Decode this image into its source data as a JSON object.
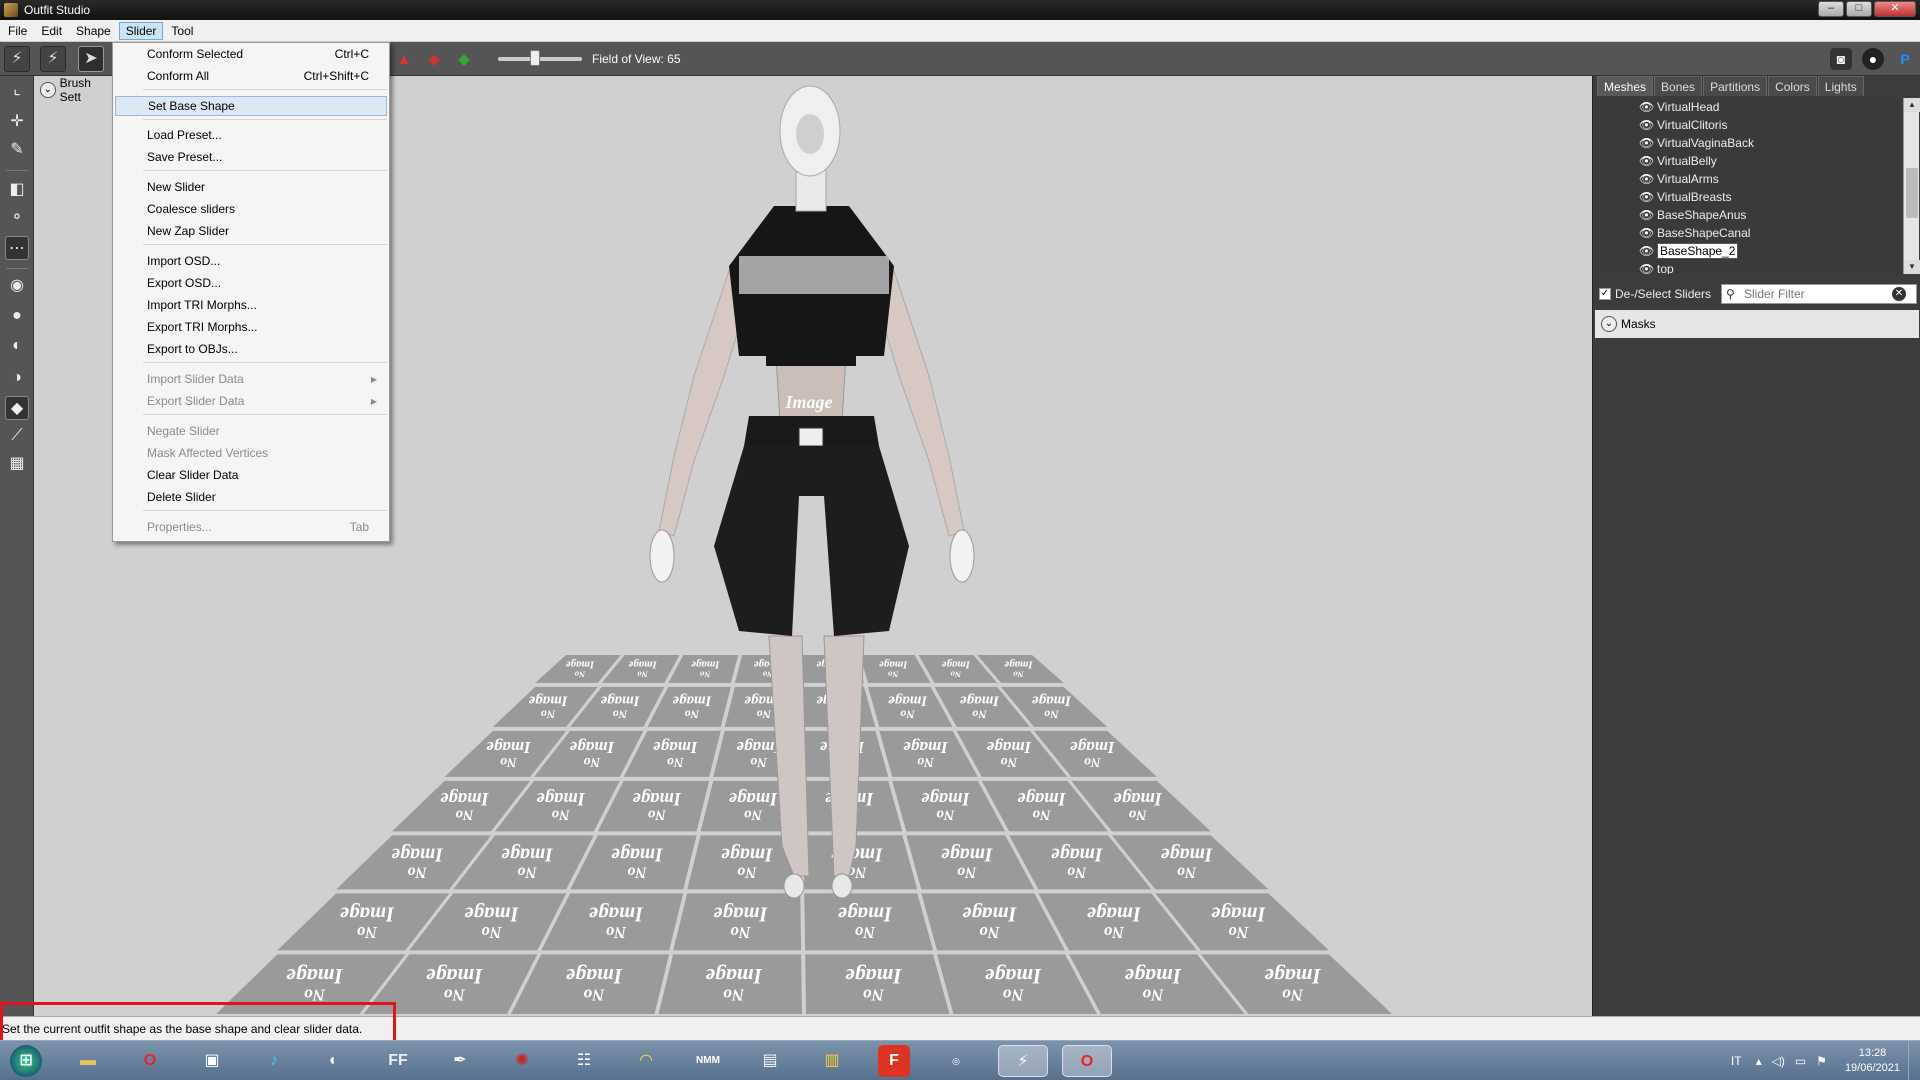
{
  "window": {
    "title": "Outfit Studio",
    "min": "–",
    "max": "□",
    "close": "✕"
  },
  "menubar": {
    "items": [
      "File",
      "Edit",
      "Shape",
      "Slider",
      "Tool"
    ]
  },
  "toolbar": {
    "fov_label": "Field of View: 65",
    "fov_value": 65
  },
  "brush_settings": {
    "label": "Brush Sett"
  },
  "slider_menu": {
    "items": [
      {
        "label": "Conform Selected",
        "shortcut": "Ctrl+C"
      },
      {
        "label": "Conform All",
        "shortcut": "Ctrl+Shift+C"
      },
      {
        "label": "Set Base Shape",
        "shortcut": ""
      },
      {
        "label": "Load Preset...",
        "shortcut": ""
      },
      {
        "label": "Save Preset...",
        "shortcut": ""
      },
      {
        "label": "New Slider",
        "shortcut": ""
      },
      {
        "label": "Coalesce sliders",
        "shortcut": ""
      },
      {
        "label": "New Zap Slider",
        "shortcut": ""
      },
      {
        "label": "Import OSD...",
        "shortcut": ""
      },
      {
        "label": "Export OSD...",
        "shortcut": ""
      },
      {
        "label": "Import TRI Morphs...",
        "shortcut": ""
      },
      {
        "label": "Export TRI Morphs...",
        "shortcut": ""
      },
      {
        "label": "Export to OBJs...",
        "shortcut": ""
      },
      {
        "label": "Import Slider Data",
        "shortcut": ""
      },
      {
        "label": "Export Slider Data",
        "shortcut": ""
      },
      {
        "label": "Negate Slider",
        "shortcut": ""
      },
      {
        "label": "Mask Affected Vertices",
        "shortcut": ""
      },
      {
        "label": "Clear Slider Data",
        "shortcut": ""
      },
      {
        "label": "Delete Slider",
        "shortcut": ""
      },
      {
        "label": "Properties...",
        "shortcut": "Tab"
      }
    ]
  },
  "right_panel": {
    "tabs": [
      "Meshes",
      "Bones",
      "Partitions",
      "Colors",
      "Lights"
    ],
    "meshes": [
      "VirtualHead",
      "VirtualClitoris",
      "VirtualVaginaBack",
      "VirtualBelly",
      "VirtualArms",
      "VirtualBreasts",
      "BaseShapeAnus",
      "BaseShapeCanal",
      "BaseShape_2",
      "top"
    ],
    "selected_mesh": "BaseShape_2",
    "deselect_label": "De-/Select Sliders",
    "filter_placeholder": "Slider Filter",
    "masks_label": "Masks"
  },
  "viewport": {
    "floor_tile_text_top": "Image",
    "floor_tile_text_bottom": "No",
    "chest_texture_text": "Image",
    "tile_color": "#9a9a9a",
    "background_color": "#d0d0d0"
  },
  "statusbar": {
    "text": "Set the current outfit shape as the base shape and clear slider data."
  },
  "taskbar": {
    "icons": [
      "windows-start",
      "file-explorer",
      "opera",
      "media-player",
      "music-app",
      "audio-tool",
      "ffdec",
      "feather-tool",
      "spider-game",
      "people-app",
      "headphones-app",
      "nmm-manager",
      "notepad-app",
      "folder-app",
      "f-app",
      "creation-kit",
      "outfit-studio",
      "opera-browser"
    ],
    "tray_lang": "IT",
    "time": "13:28",
    "date": "19/06/2021"
  },
  "colors": {
    "highlight_box": "#e0141e",
    "menu_hover": "#dde8f5"
  }
}
